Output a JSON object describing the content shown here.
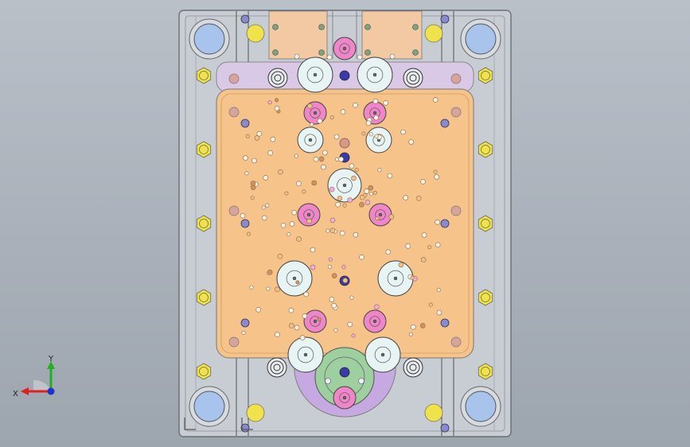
{
  "viewport": {
    "background_top": "#b9c0c8",
    "background_bottom": "#9da5ae"
  },
  "triad": {
    "x_label": "X",
    "y_label": "Y",
    "x_color": "#e02020",
    "y_color": "#20b020",
    "z_color": "#2030d0"
  },
  "colors": {
    "plate_gray": "#c9ced4",
    "cavity_orange": "#f6c489",
    "header_lavender": "#d8c8e6",
    "pin_pink": "#ef86c8",
    "pin_white": "#e8f4f4",
    "bushing_blue": "#a9c4ec",
    "screw_yellow": "#f0e24a",
    "sprue_green": "#9ccc9c",
    "sprue_purple": "#c8a8e0",
    "bolt_blue": "#3a3aa8"
  },
  "icons": [
    "triad-axis-icon",
    "corner-l-mark-icon"
  ]
}
